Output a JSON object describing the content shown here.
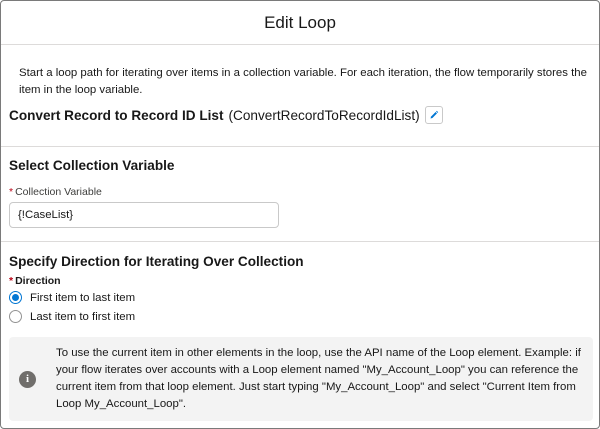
{
  "modal": {
    "title": "Edit Loop"
  },
  "intro": {
    "text": "Start a loop path for iterating over items in a collection variable. For each iteration, the flow temporarily stores the item in the loop variable."
  },
  "element": {
    "label": "Convert Record to Record ID List",
    "api_name": "(ConvertRecordToRecordIdList)",
    "edit_icon": "pencil-icon"
  },
  "collection_section": {
    "title": "Select Collection Variable",
    "field_label": "Collection Variable",
    "required_marker": "*",
    "value": "{!CaseList}"
  },
  "direction_section": {
    "title": "Specify Direction for Iterating Over Collection",
    "field_label": "Direction",
    "required_marker": "*",
    "options": [
      {
        "label": "First item to last item",
        "selected": true
      },
      {
        "label": "Last item to first item",
        "selected": false
      }
    ]
  },
  "info": {
    "icon": "info-icon",
    "text": "To use the current item in other elements in the loop, use the API name of the Loop element. Example: if your flow iterates over accounts with a Loop element named \"My_Account_Loop\" you can reference the current item from that loop element. Just start typing \"My_Account_Loop\" and select \"Current Item from Loop My_Account_Loop\"."
  },
  "colors": {
    "accent": "#0176d3",
    "required": "#ba0517",
    "info_bg": "#f3f3f3",
    "info_icon": "#706e6b"
  }
}
